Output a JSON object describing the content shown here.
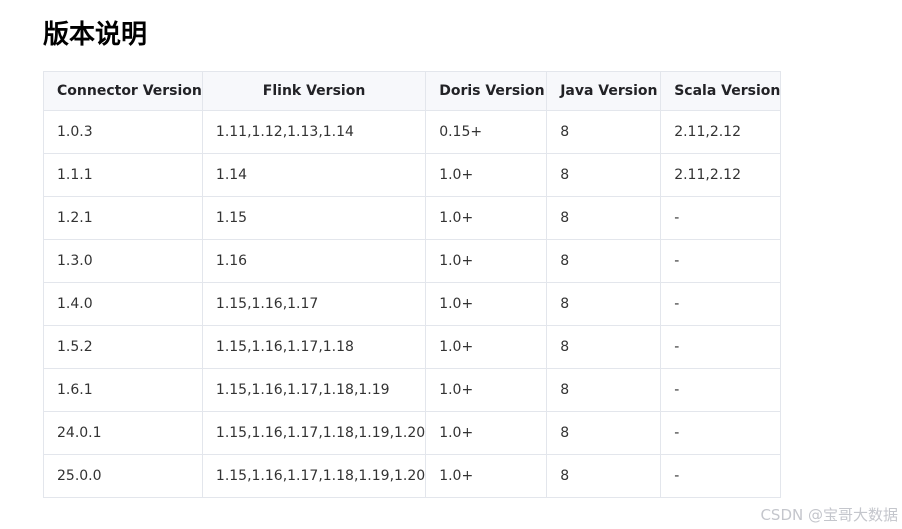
{
  "heading": "版本说明",
  "table": {
    "headers": [
      "Connector Version",
      "Flink Version",
      "Doris Version",
      "Java Version",
      "Scala Version"
    ],
    "rows": [
      [
        "1.0.3",
        "1.11,1.12,1.13,1.14",
        "0.15+",
        "8",
        "2.11,2.12"
      ],
      [
        "1.1.1",
        "1.14",
        "1.0+",
        "8",
        "2.11,2.12"
      ],
      [
        "1.2.1",
        "1.15",
        "1.0+",
        "8",
        "-"
      ],
      [
        "1.3.0",
        "1.16",
        "1.0+",
        "8",
        "-"
      ],
      [
        "1.4.0",
        "1.15,1.16,1.17",
        "1.0+",
        "8",
        "-"
      ],
      [
        "1.5.2",
        "1.15,1.16,1.17,1.18",
        "1.0+",
        "8",
        "-"
      ],
      [
        "1.6.1",
        "1.15,1.16,1.17,1.18,1.19",
        "1.0+",
        "8",
        "-"
      ],
      [
        "24.0.1",
        "1.15,1.16,1.17,1.18,1.19,1.20",
        "1.0+",
        "8",
        "-"
      ],
      [
        "25.0.0",
        "1.15,1.16,1.17,1.18,1.19,1.20",
        "1.0+",
        "8",
        "-"
      ]
    ]
  },
  "watermark": "CSDN @宝哥大数据"
}
